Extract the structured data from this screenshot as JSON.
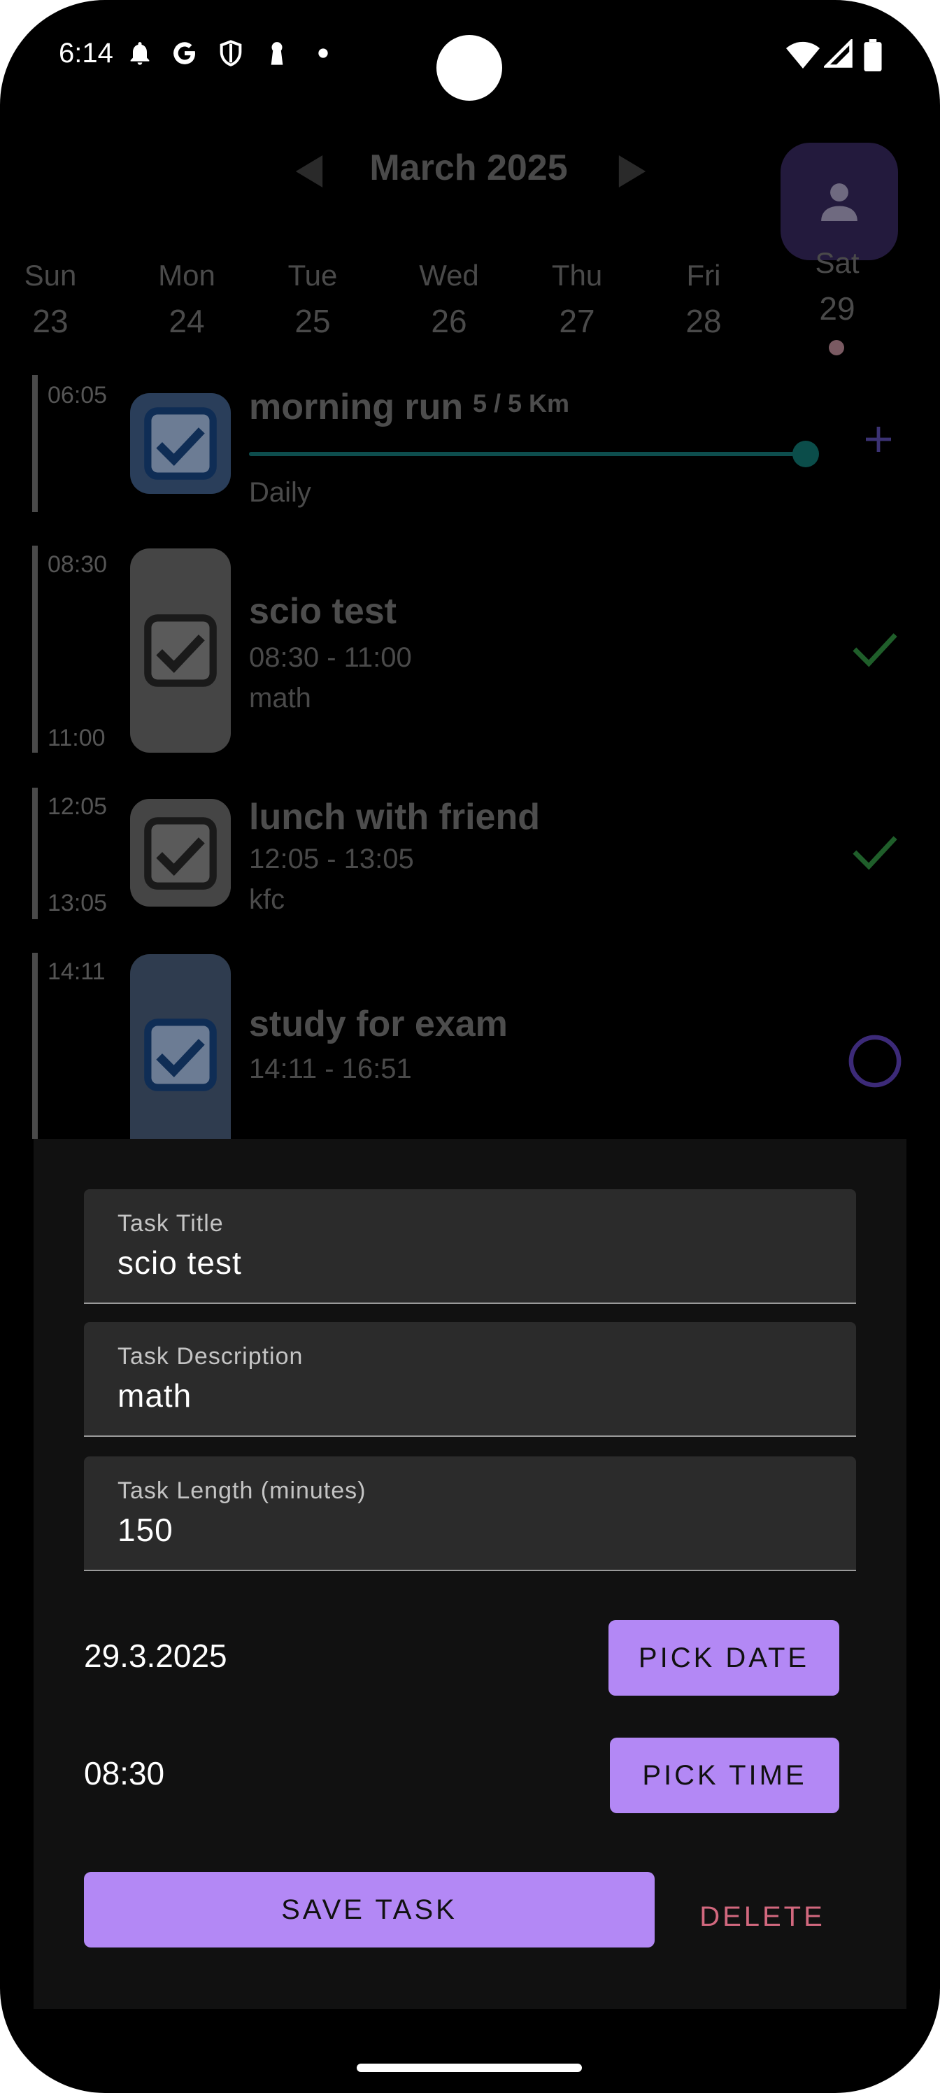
{
  "status_bar": {
    "time": "6:14",
    "icons": [
      "notification-bell-icon",
      "google-icon",
      "shield-icon",
      "keyhole-icon",
      "dot-icon",
      "wifi-icon",
      "signal-icon",
      "battery-icon"
    ]
  },
  "calendar": {
    "month": "March 2025",
    "days": [
      {
        "name": "Sun",
        "number": "23"
      },
      {
        "name": "Mon",
        "number": "24"
      },
      {
        "name": "Tue",
        "number": "25"
      },
      {
        "name": "Wed",
        "number": "26"
      },
      {
        "name": "Thu",
        "number": "27"
      },
      {
        "name": "Fri",
        "number": "28"
      },
      {
        "name": "Sat",
        "number": "29"
      }
    ],
    "selected_day": "Sat"
  },
  "tasks": [
    {
      "start": "06:05",
      "title": "morning run",
      "progress_label": "5 / 5 Km",
      "progress_fraction": 1.0,
      "repeat": "Daily",
      "action": "plus-icon"
    },
    {
      "start": "08:30",
      "end": "11:00",
      "title": "scio test",
      "time_range": "08:30 - 11:00",
      "description": "math",
      "status": "check-icon"
    },
    {
      "start": "12:05",
      "end": "13:05",
      "title": "lunch with friend",
      "time_range": "12:05 - 13:05",
      "description": "kfc",
      "status": "check-icon"
    },
    {
      "start": "14:11",
      "title": "study for exam",
      "time_range": "14:11 - 16:51",
      "status": "circle-icon"
    }
  ],
  "editor": {
    "title_label": "Task Title",
    "title_value": "scio test",
    "description_label": "Task Description",
    "description_value": "math",
    "length_label": "Task Length (minutes)",
    "length_value": "150",
    "date_value": "29.3.2025",
    "pick_date_label": "PICK DATE",
    "time_value": "08:30",
    "pick_time_label": "PICK TIME",
    "save_label": "SAVE TASK",
    "delete_label": "DELETE"
  },
  "colors": {
    "accent": "#b388f5",
    "delete": "#d2687e",
    "done_check": "#1f5e2a",
    "pending_circle": "#3c2a78"
  }
}
